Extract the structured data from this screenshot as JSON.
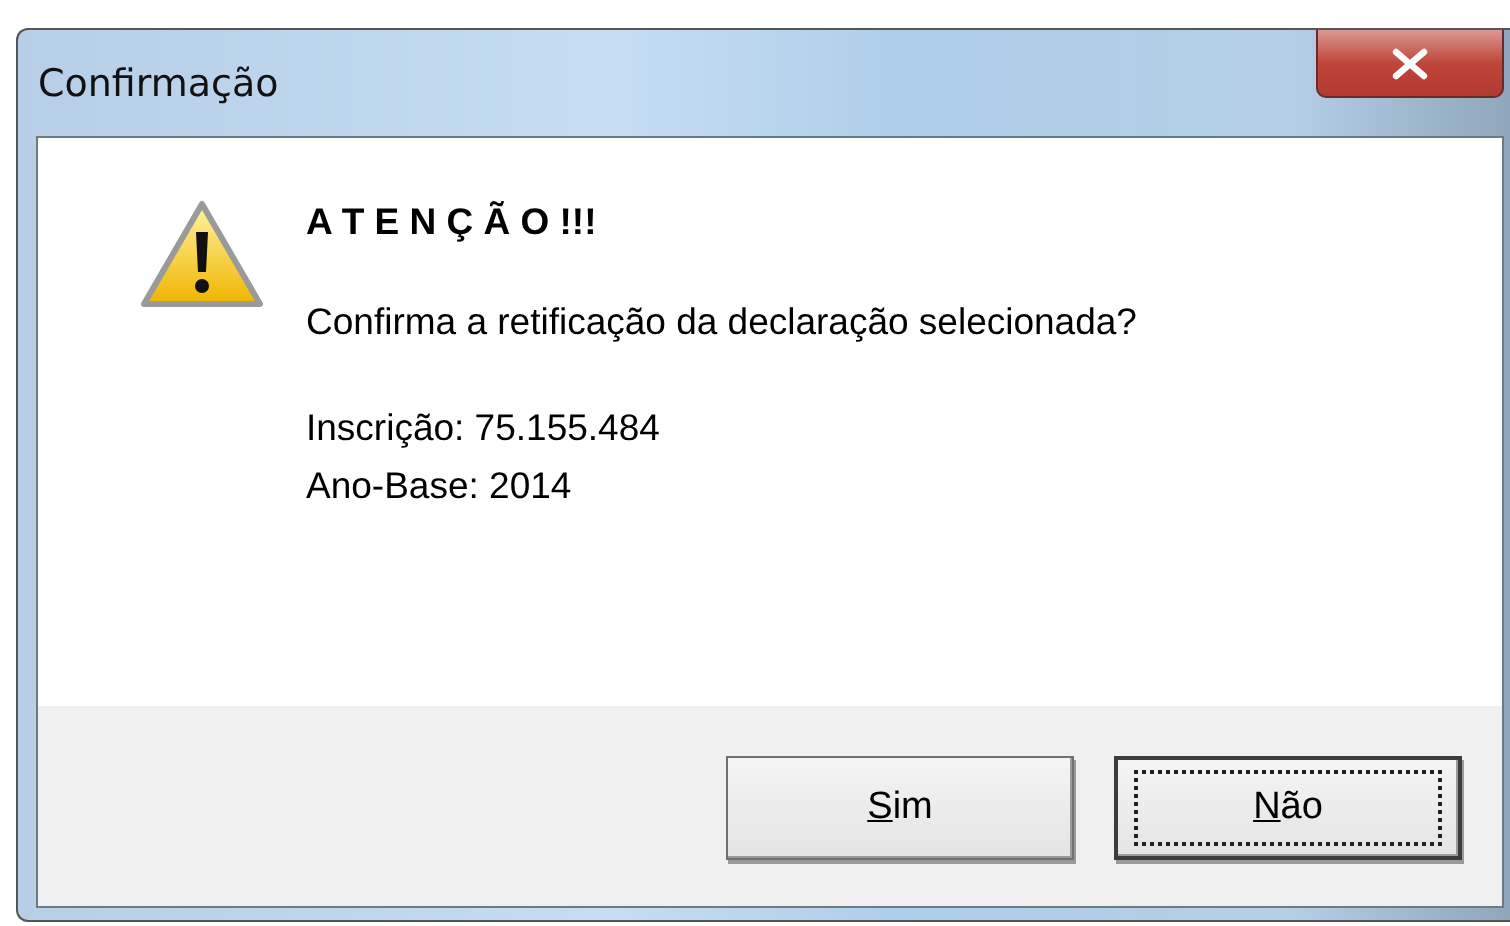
{
  "window": {
    "title": "Confirmação"
  },
  "message": {
    "heading": "A T E N Ç Ã O !!!",
    "question": "Confirma a retificação da declaração selecionada?",
    "details": [
      "Inscrição: 75.155.484",
      "Ano-Base: 2014"
    ]
  },
  "buttons": [
    {
      "accesskey": "S",
      "label_rest": "im",
      "focused": false
    },
    {
      "accesskey": "N",
      "label_rest": "ão",
      "focused": true
    }
  ]
}
